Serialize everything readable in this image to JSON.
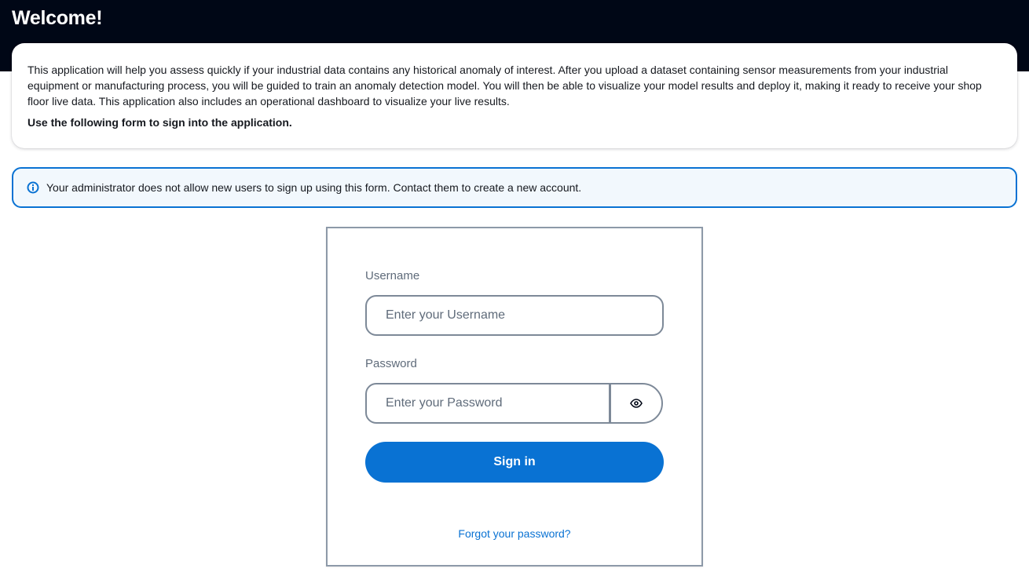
{
  "header": {
    "title": "Welcome!"
  },
  "intro": {
    "description": "This application will help you assess quickly if your industrial data contains any historical anomaly of interest. After you upload a dataset containing sensor measurements from your industrial equipment or manufacturing process, you will be guided to train an anomaly detection model. You will then be able to visualize your model results and deploy it, making it ready to receive your shop floor live data. This application also includes an operational dashboard to visualize your live results.",
    "cta": "Use the following form to sign into the application."
  },
  "alert": {
    "icon": "info-icon",
    "text": "Your administrator does not allow new users to sign up using this form. Contact them to create a new account."
  },
  "signin_form": {
    "username_label": "Username",
    "username_placeholder": "Enter your Username",
    "username_value": "",
    "password_label": "Password",
    "password_placeholder": "Enter your Password",
    "password_value": "",
    "show_password_icon": "eye-icon",
    "submit_label": "Sign in",
    "forgot_password_label": "Forgot your password?"
  },
  "colors": {
    "header_background": "#000716",
    "primary": "#0972d3",
    "alert_background": "#f2f8fd",
    "input_border": "#7d8998",
    "label_text": "#5f6b7a"
  }
}
